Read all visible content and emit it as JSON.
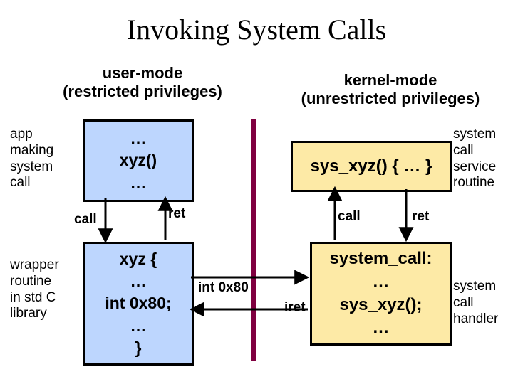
{
  "title": "Invoking System Calls",
  "headers": {
    "user": "user-mode\n(restricted privileges)",
    "kernel": "kernel-mode\n(unrestricted privileges)"
  },
  "side_labels": {
    "app": "app\nmaking\nsystem\ncall",
    "wrapper": "wrapper\nroutine\nin std C\nlibrary",
    "service": "system\ncall\nservice\nroutine",
    "handler": "system\ncall\nhandler"
  },
  "boxes": {
    "app_code": "…\nxyz()\n…",
    "wrapper_code": "xyz {\n…\nint 0x80;\n…\n}",
    "service_code": "sys_xyz() { … }",
    "handler_code": "system_call:\n…\nsys_xyz();\n…"
  },
  "arrow_labels": {
    "call_left": "call",
    "ret_left": "ret",
    "int_right": "int 0x80",
    "iret_left": "iret",
    "call_right": "call",
    "ret_right": "ret"
  }
}
